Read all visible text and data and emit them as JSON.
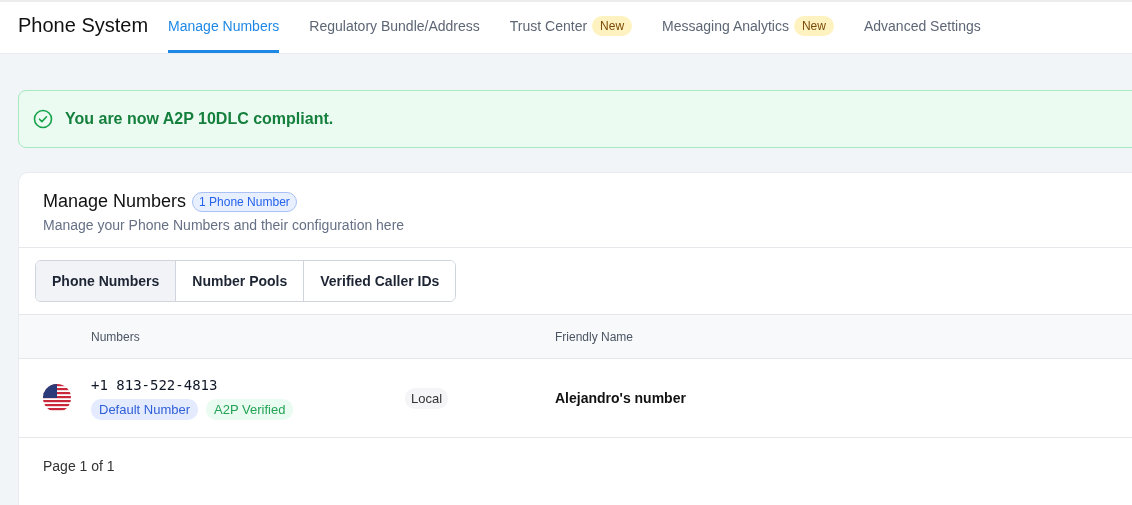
{
  "header": {
    "title": "Phone System",
    "tabs": [
      {
        "label": "Manage Numbers",
        "selected": true
      },
      {
        "label": "Regulatory Bundle/Address",
        "selected": false
      },
      {
        "label": "Trust Center",
        "selected": false,
        "badge": "New"
      },
      {
        "label": "Messaging Analytics",
        "selected": false,
        "badge": "New"
      },
      {
        "label": "Advanced Settings",
        "selected": false
      }
    ]
  },
  "banner": {
    "message": "You are now A2P 10DLC compliant."
  },
  "card": {
    "title": "Manage Numbers",
    "count_badge": "1 Phone Number",
    "subtitle": "Manage your Phone Numbers and their configuration here",
    "segments": [
      {
        "label": "Phone Numbers",
        "selected": true
      },
      {
        "label": "Number Pools",
        "selected": false
      },
      {
        "label": "Verified Caller IDs",
        "selected": false
      }
    ],
    "table": {
      "columns": [
        "Numbers",
        "Friendly Name"
      ],
      "rows": [
        {
          "number": "+1 813-522-4813",
          "tags": [
            {
              "label": "Default Number",
              "kind": "default"
            },
            {
              "label": "A2P Verified",
              "kind": "verified"
            }
          ],
          "type": "Local",
          "friendly_name": "Alejandro's number"
        }
      ]
    },
    "pagination": "Page 1 of 1"
  }
}
